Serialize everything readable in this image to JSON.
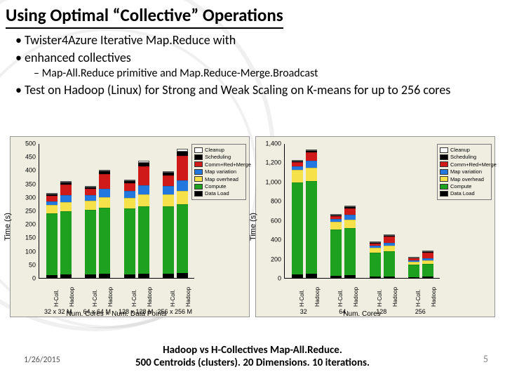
{
  "title": "Using Optimal “Collective” Operations",
  "bullets": {
    "b1a": "Twister4Azure Iterative Map.Reduce with",
    "b1b": "enhanced collectives",
    "b2": "Map-All.Reduce primitive and Map.Reduce-Merge.Broadcast",
    "b3": "Test on Hadoop (Linux) for Strong and Weak Scaling on K-means for up to 256 cores"
  },
  "legend_items": [
    {
      "name": "Cleanup",
      "color": "#ffffff"
    },
    {
      "name": "Scheduling",
      "color": "#000000"
    },
    {
      "name": "Comm+Red+Merge",
      "color": "#d01919"
    },
    {
      "name": "Map variation",
      "color": "#2278de"
    },
    {
      "name": "Map overhead",
      "color": "#f6e14a"
    },
    {
      "name": "Compute",
      "color": "#1ea11e"
    },
    {
      "name": "Data Load",
      "color": "#000000"
    }
  ],
  "caption_l1": "Hadoop vs H-Collectives Map-All.Reduce.",
  "caption_l2": "500 Centroids (clusters). 20 Dimensions. 10 iterations.",
  "footer_date": "1/26/2015",
  "slide_number": "5",
  "chart_data": [
    {
      "type": "bar",
      "title": "",
      "ylabel": "Time (s)",
      "xlabel": "Num. Cores × Num. Data Points",
      "ylim": [
        0,
        500
      ],
      "yticks": [
        0,
        50,
        100,
        150,
        200,
        250,
        300,
        350,
        400,
        450,
        500
      ],
      "bar_tick": "H-Coll./Hadoop",
      "groups": [
        "32 x 32 M",
        "64 x 64 M",
        "128 x 128 M",
        "256 x 256 M"
      ],
      "stacks": [
        "Data Load",
        "Compute",
        "Map overhead",
        "Map variation",
        "Comm+Red+Merge",
        "Scheduling",
        "Cleanup"
      ],
      "colors": {
        "Data Load": "#000000",
        "Compute": "#1ea11e",
        "Map overhead": "#f6e14a",
        "Map variation": "#2278de",
        "Comm+Red+Merge": "#d01919",
        "Scheduling": "#000000",
        "Cleanup": "#ffffff"
      },
      "series": [
        {
          "group": "32 x 32 M",
          "bar": "H-Coll.",
          "values": {
            "Data Load": 10,
            "Compute": 230,
            "Map overhead": 30,
            "Map variation": 15,
            "Comm+Red+Merge": 20,
            "Scheduling": 5,
            "Cleanup": 5
          }
        },
        {
          "group": "32 x 32 M",
          "bar": "Hadoop",
          "values": {
            "Data Load": 12,
            "Compute": 235,
            "Map overhead": 35,
            "Map variation": 25,
            "Comm+Red+Merge": 40,
            "Scheduling": 8,
            "Cleanup": 5
          }
        },
        {
          "group": "64 x 64 M",
          "bar": "H-Coll.",
          "values": {
            "Data Load": 12,
            "Compute": 240,
            "Map overhead": 35,
            "Map variation": 20,
            "Comm+Red+Merge": 25,
            "Scheduling": 5,
            "Cleanup": 5
          }
        },
        {
          "group": "64 x 64 M",
          "bar": "Hadoop",
          "values": {
            "Data Load": 15,
            "Compute": 245,
            "Map overhead": 40,
            "Map variation": 30,
            "Comm+Red+Merge": 55,
            "Scheduling": 10,
            "Cleanup": 5
          }
        },
        {
          "group": "128 x 128 M",
          "bar": "H-Coll.",
          "values": {
            "Data Load": 12,
            "Compute": 245,
            "Map overhead": 40,
            "Map variation": 25,
            "Comm+Red+Merge": 30,
            "Scheduling": 8,
            "Cleanup": 5
          }
        },
        {
          "group": "128 x 128 M",
          "bar": "Hadoop",
          "values": {
            "Data Load": 15,
            "Compute": 250,
            "Map overhead": 45,
            "Map variation": 35,
            "Comm+Red+Merge": 70,
            "Scheduling": 12,
            "Cleanup": 8
          }
        },
        {
          "group": "256 x 256 M",
          "bar": "H-Coll.",
          "values": {
            "Data Load": 15,
            "Compute": 250,
            "Map overhead": 45,
            "Map variation": 30,
            "Comm+Red+Merge": 40,
            "Scheduling": 10,
            "Cleanup": 5
          }
        },
        {
          "group": "256 x 256 M",
          "bar": "Hadoop",
          "values": {
            "Data Load": 18,
            "Compute": 255,
            "Map overhead": 50,
            "Map variation": 40,
            "Comm+Red+Merge": 90,
            "Scheduling": 15,
            "Cleanup": 10
          }
        }
      ]
    },
    {
      "type": "bar",
      "title": "",
      "ylabel": "Time (s)",
      "xlabel": "Num. Cores",
      "ylim": [
        0,
        1400
      ],
      "yticks": [
        0,
        200,
        400,
        600,
        800,
        1000,
        1200,
        1400
      ],
      "bar_tick": "H-Coll./Hadoop",
      "groups": [
        "32",
        "64",
        "128",
        "256"
      ],
      "stacks": [
        "Data Load",
        "Compute",
        "Map overhead",
        "Map variation",
        "Comm+Red+Merge",
        "Scheduling",
        "Cleanup"
      ],
      "colors": {
        "Data Load": "#000000",
        "Compute": "#1ea11e",
        "Map overhead": "#f6e14a",
        "Map variation": "#2278de",
        "Comm+Red+Merge": "#d01919",
        "Scheduling": "#000000",
        "Cleanup": "#ffffff"
      },
      "series": [
        {
          "group": "32",
          "bar": "H-Coll.",
          "values": {
            "Data Load": 40,
            "Compute": 950,
            "Map overhead": 130,
            "Map variation": 40,
            "Comm+Red+Merge": 40,
            "Scheduling": 10,
            "Cleanup": 10
          }
        },
        {
          "group": "32",
          "bar": "Hadoop",
          "values": {
            "Data Load": 45,
            "Compute": 960,
            "Map overhead": 140,
            "Map variation": 70,
            "Comm+Red+Merge": 90,
            "Scheduling": 15,
            "Cleanup": 12
          }
        },
        {
          "group": "64",
          "bar": "H-Coll.",
          "values": {
            "Data Load": 25,
            "Compute": 480,
            "Map overhead": 80,
            "Map variation": 25,
            "Comm+Red+Merge": 30,
            "Scheduling": 8,
            "Cleanup": 8
          }
        },
        {
          "group": "64",
          "bar": "Hadoop",
          "values": {
            "Data Load": 28,
            "Compute": 490,
            "Map overhead": 90,
            "Map variation": 45,
            "Comm+Red+Merge": 70,
            "Scheduling": 12,
            "Cleanup": 10
          }
        },
        {
          "group": "128",
          "bar": "H-Coll.",
          "values": {
            "Data Load": 15,
            "Compute": 250,
            "Map overhead": 50,
            "Map variation": 18,
            "Comm+Red+Merge": 25,
            "Scheduling": 6,
            "Cleanup": 6
          }
        },
        {
          "group": "128",
          "bar": "Hadoop",
          "values": {
            "Data Load": 18,
            "Compute": 260,
            "Map overhead": 55,
            "Map variation": 35,
            "Comm+Red+Merge": 60,
            "Scheduling": 10,
            "Cleanup": 8
          }
        },
        {
          "group": "256",
          "bar": "H-Coll.",
          "values": {
            "Data Load": 10,
            "Compute": 130,
            "Map overhead": 30,
            "Map variation": 12,
            "Comm+Red+Merge": 20,
            "Scheduling": 5,
            "Cleanup": 5
          }
        },
        {
          "group": "256",
          "bar": "Hadoop",
          "values": {
            "Data Load": 12,
            "Compute": 135,
            "Map overhead": 35,
            "Map variation": 25,
            "Comm+Red+Merge": 55,
            "Scheduling": 8,
            "Cleanup": 6
          }
        }
      ]
    }
  ]
}
